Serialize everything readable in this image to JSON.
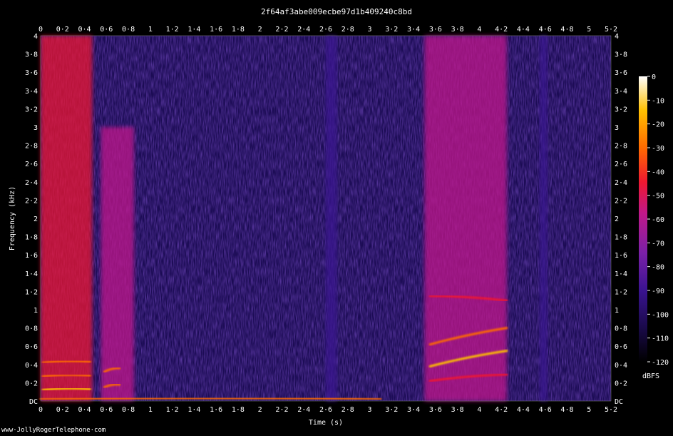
{
  "chart_data": {
    "type": "heatmap",
    "title": "2f64af3abe009ecbe97d1b409240c8bd",
    "xlabel": "Time (s)",
    "ylabel": "Frequency (kHz)",
    "xlim": [
      0,
      5.2
    ],
    "ylim": [
      0,
      4
    ],
    "x_ticks": [
      "0",
      "0·2",
      "0·4",
      "0·6",
      "0·8",
      "1",
      "1·2",
      "1·4",
      "1·6",
      "1·8",
      "2",
      "2·2",
      "2·4",
      "2·6",
      "2·8",
      "3",
      "3·2",
      "3·4",
      "3·6",
      "3·8",
      "4",
      "4·2",
      "4·4",
      "4·6",
      "4·8",
      "5",
      "5·2"
    ],
    "x_tick_values": [
      0,
      0.2,
      0.4,
      0.6,
      0.8,
      1,
      1.2,
      1.4,
      1.6,
      1.8,
      2,
      2.2,
      2.4,
      2.6,
      2.8,
      3,
      3.2,
      3.4,
      3.6,
      3.8,
      4,
      4.2,
      4.4,
      4.6,
      4.8,
      5,
      5.2
    ],
    "y_ticks": [
      "DC",
      "0·2",
      "0·4",
      "0·6",
      "0·8",
      "1",
      "1·2",
      "1·4",
      "1·6",
      "1·8",
      "2",
      "2·2",
      "2·4",
      "2·6",
      "2·8",
      "3",
      "3·2",
      "3·4",
      "3·6",
      "3·8",
      "4"
    ],
    "y_tick_values": [
      0,
      0.2,
      0.4,
      0.6,
      0.8,
      1,
      1.2,
      1.4,
      1.6,
      1.8,
      2,
      2.2,
      2.4,
      2.6,
      2.8,
      3,
      3.2,
      3.4,
      3.6,
      3.8,
      4
    ],
    "colorbar": {
      "label": "dBFS",
      "ticks": [
        "0",
        "-10",
        "-20",
        "-30",
        "-40",
        "-50",
        "-60",
        "-70",
        "-80",
        "-90",
        "-100",
        "-110",
        "-120"
      ],
      "tick_values": [
        0,
        -10,
        -20,
        -30,
        -40,
        -50,
        -60,
        -70,
        -80,
        -90,
        -100,
        -110,
        -120
      ],
      "range": [
        -120,
        0
      ]
    },
    "colormap": [
      "#000000",
      "#1a0a4a",
      "#3a1390",
      "#7a20a8",
      "#c0188a",
      "#ee1830",
      "#ff6a00",
      "#ffc000",
      "#ffffff"
    ],
    "energy_regions": [
      {
        "t_start": 0.0,
        "t_end": 0.47,
        "f_max": 4.0,
        "level_db": -45
      },
      {
        "t_start": 0.55,
        "t_end": 0.85,
        "f_max": 3.0,
        "level_db": -60
      },
      {
        "t_start": 2.6,
        "t_end": 2.7,
        "f_max": 4.0,
        "level_db": -85
      },
      {
        "t_start": 3.5,
        "t_end": 4.25,
        "f_max": 4.0,
        "level_db": -65
      },
      {
        "t_start": 4.55,
        "t_end": 4.62,
        "f_max": 4.0,
        "level_db": -85
      }
    ],
    "harmonic_tracks": [
      {
        "t_start": 0.02,
        "t_end": 0.45,
        "f_start": 0.12,
        "f_end": 0.13,
        "level_db": -20
      },
      {
        "t_start": 0.02,
        "t_end": 0.45,
        "f_start": 0.27,
        "f_end": 0.28,
        "level_db": -25
      },
      {
        "t_start": 0.02,
        "t_end": 0.45,
        "f_start": 0.42,
        "f_end": 0.43,
        "level_db": -30
      },
      {
        "t_start": 0.58,
        "t_end": 0.72,
        "f_start": 0.15,
        "f_end": 0.18,
        "level_db": -25
      },
      {
        "t_start": 0.58,
        "t_end": 0.72,
        "f_start": 0.32,
        "f_end": 0.36,
        "level_db": -30
      },
      {
        "t_start": 3.55,
        "t_end": 4.25,
        "f_start": 0.38,
        "f_end": 0.55,
        "level_db": -20
      },
      {
        "t_start": 3.55,
        "t_end": 4.25,
        "f_start": 0.62,
        "f_end": 0.8,
        "level_db": -30
      },
      {
        "t_start": 3.55,
        "t_end": 4.25,
        "f_start": 0.22,
        "f_end": 0.29,
        "level_db": -40
      },
      {
        "t_start": 3.55,
        "t_end": 4.25,
        "f_start": 1.15,
        "f_end": 1.1,
        "level_db": -45
      },
      {
        "t_start": 0.0,
        "t_end": 3.1,
        "f_start": 0.02,
        "f_end": 0.02,
        "level_db": -35
      }
    ],
    "grid": false,
    "legend": "colorbar-right"
  },
  "watermark": "www·JollyRogerTelephone·com"
}
